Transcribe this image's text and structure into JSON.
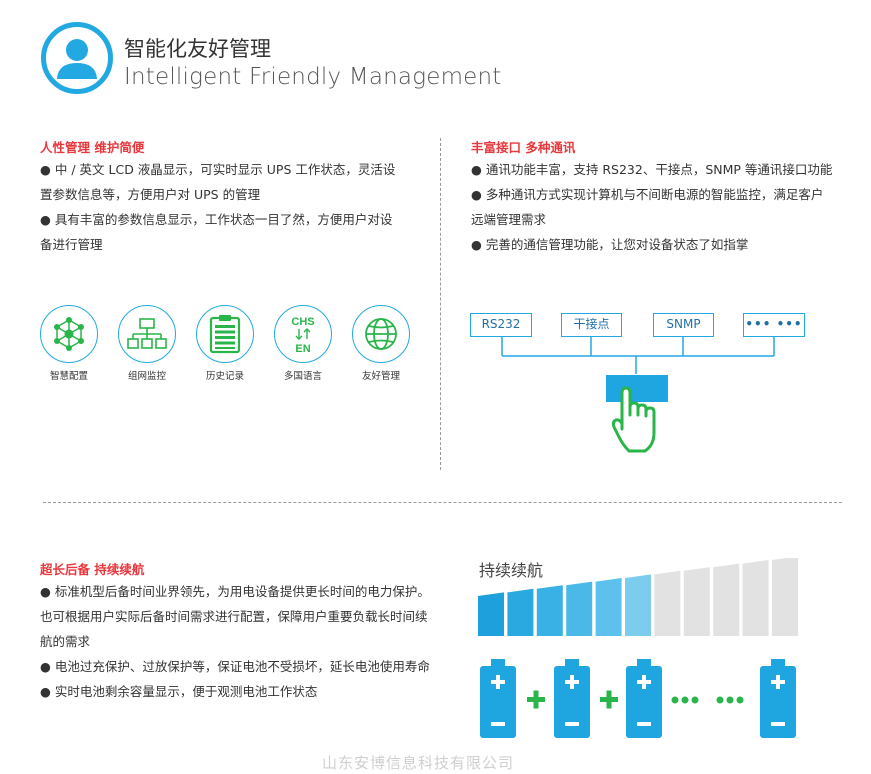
{
  "header": {
    "title_cn": "智能化友好管理",
    "title_en": "Intelligent Friendly Management",
    "icon": "user-icon",
    "accent_color": "#22a9e1"
  },
  "section_left": {
    "title": "人性管理 维护简便",
    "lines": [
      "● 中 / 英文 LCD 液晶显示，可实时显示 UPS 工作状态，灵活设",
      "置参数信息等，方便用户对 UPS 的管理",
      "● 具有丰富的参数信息显示，工作状态一目了然，方便用户对设",
      "备进行管理"
    ],
    "features": [
      {
        "label": "智慧配置",
        "icon": "network-hub-icon"
      },
      {
        "label": "组网监控",
        "icon": "org-chart-icon"
      },
      {
        "label": "历史记录",
        "icon": "clipboard-icon"
      },
      {
        "label": "多国语言",
        "icon": "language-icon",
        "text_top": "CHS",
        "text_bottom": "EN"
      },
      {
        "label": "友好管理",
        "icon": "globe-icon"
      }
    ]
  },
  "section_right": {
    "title": "丰富接口 多种通讯",
    "lines": [
      "● 通讯功能丰富，支持 RS232、干接点，SNMP 等通讯接口功能",
      "● 多种通讯方式实现计算机与不间断电源的智能监控，满足客户",
      "远端管理需求",
      "● 完善的通信管理功能，让您对设备状态了如指掌"
    ],
    "ports": [
      "RS232",
      "干接点",
      "SNMP",
      "••• •••"
    ],
    "hand_icon": "pointing-hand-icon",
    "hand_color": "#2ab54b"
  },
  "section_bottom": {
    "title": "超长后备 持续续航",
    "lines": [
      "● 标准机型后备时间业界领先，为用电设备提供更长时间的电力保护。",
      "也可根据用户实际后备时间需求进行配置，保障用户重要负载长时间续",
      "航的需求",
      "● 电池过充保护、过放保护等，保证电池不受损坏，延长电池使用寿命",
      "● 实时电池剩余容量显示，便于观测电池工作状态"
    ],
    "bars_label": "持续续航",
    "bar_colors": [
      "#1ea0dc",
      "#2aa9e0",
      "#39b1e4",
      "#4ab9e8",
      "#5cc1ec",
      "#7ccded",
      "#e2e2e2",
      "#e2e2e2",
      "#e2e2e2",
      "#e2e2e2",
      "#e2e2e2"
    ],
    "batteries": 4,
    "plus_color": "#2ab54b",
    "battery_color": "#1fa6e0"
  },
  "watermark": "山东安博信息科技有限公司"
}
